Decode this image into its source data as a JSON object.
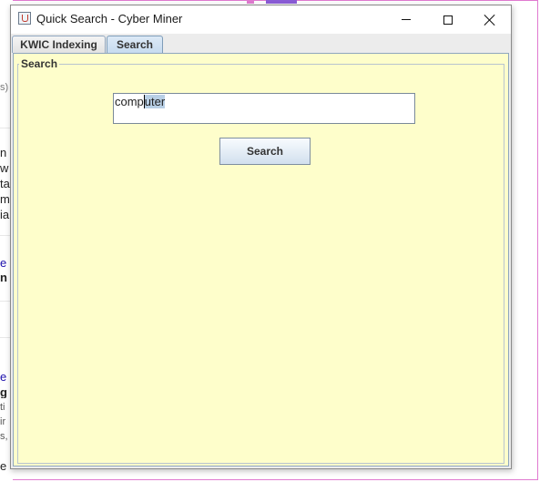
{
  "window": {
    "title": "Quick Search - Cyber Miner",
    "icon": "java-cup-icon"
  },
  "tabs": [
    {
      "label": "KWIC Indexing",
      "active": false
    },
    {
      "label": "Search",
      "active": true
    }
  ],
  "search_panel": {
    "group_title": "Search",
    "input_value": "computer",
    "input_parts": [
      "comp",
      "u",
      "ter"
    ],
    "button_label": "Search"
  },
  "background_fragments": [
    "s)",
    "n",
    "w",
    "ta",
    "m",
    "ia",
    "e",
    "n",
    "e",
    "g",
    "ti",
    "ir",
    "s,",
    "e"
  ],
  "colors": {
    "panel_bg": "#fefecb",
    "active_tab": "#c7dbef",
    "selection": "#b8cfe5",
    "frame_accent": "#e07ad0"
  }
}
